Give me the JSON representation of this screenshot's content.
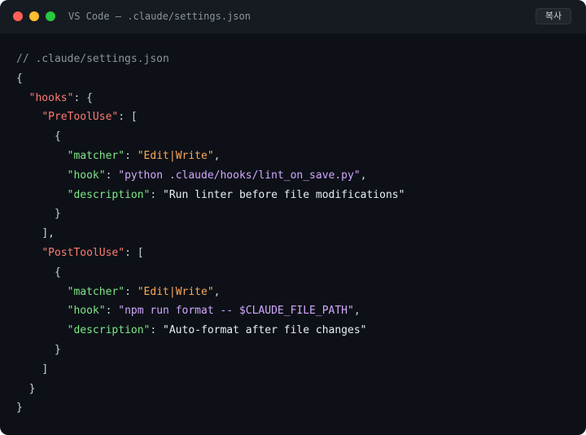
{
  "window": {
    "title": "VS Code — .claude/settings.json",
    "copy_label": "복사"
  },
  "code": {
    "comment": "// .claude/settings.json",
    "root_open": "{",
    "hooks_key": "\"hooks\"",
    "hooks_open": ": {",
    "pre_key": "\"PreToolUse\"",
    "pre_open": ": [",
    "pre_obj_open": "{",
    "matcher_key": "\"matcher\"",
    "pre_matcher_val": "\"Edit|Write\"",
    "hook_key": "\"hook\"",
    "pre_hook_val": "\"python .claude/hooks/lint_on_save.py\"",
    "description_key": "\"description\"",
    "pre_desc_val": "\"Run linter before file modifications\"",
    "pre_obj_close": "}",
    "pre_close": "],",
    "post_key": "\"PostToolUse\"",
    "post_open": ": [",
    "post_obj_open": "{",
    "post_matcher_val": "\"Edit|Write\"",
    "post_hook_val": "\"npm run format -- $CLAUDE_FILE_PATH\"",
    "post_desc_val": "\"Auto-format after file changes\"",
    "post_obj_close": "}",
    "post_close": "]",
    "hooks_close": "}",
    "root_close": "}",
    "sep": ": ",
    "comma": ","
  },
  "colors": {
    "background": "#0d1117",
    "titlebar": "#161b22",
    "key": "#ff7b72",
    "inner_key": "#7ee787",
    "matcher_value": "#ffa657",
    "hook_value": "#d2a8ff"
  }
}
